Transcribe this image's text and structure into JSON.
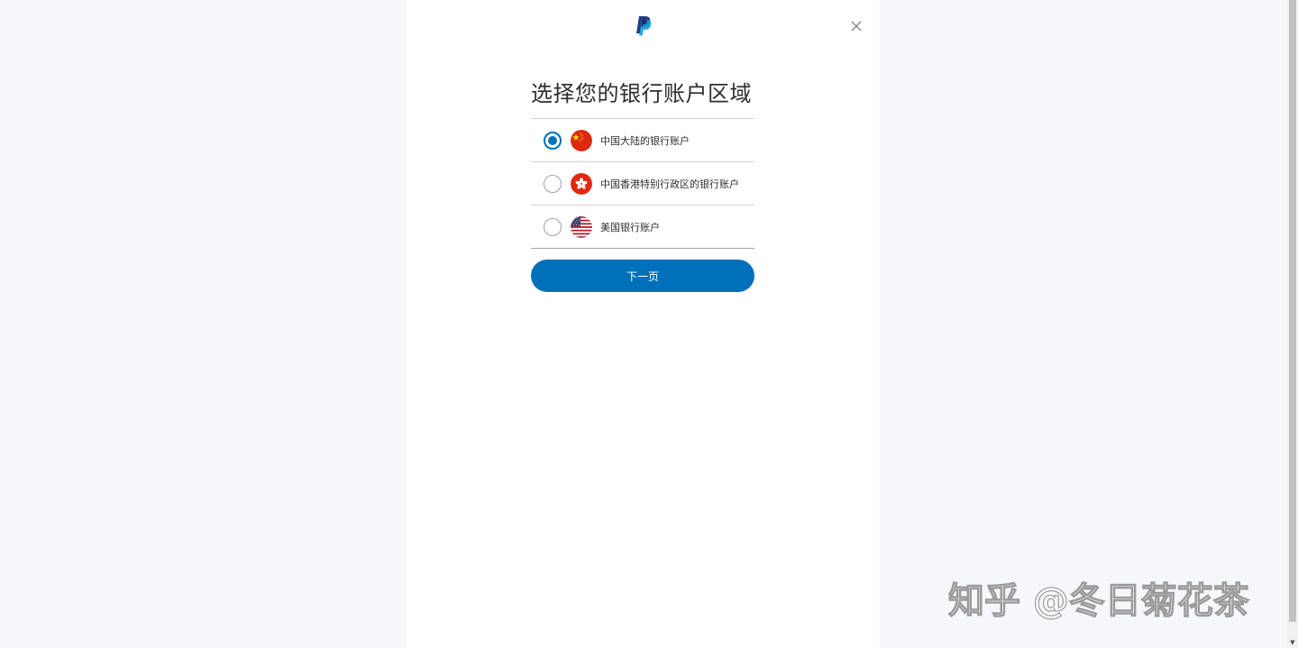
{
  "dialog": {
    "title": "选择您的银行账户区域",
    "logo_icon": "paypal-logo",
    "close_icon": "close-icon"
  },
  "options": [
    {
      "label": "中国大陆的银行账户",
      "flag": "china-flag-icon",
      "selected": true
    },
    {
      "label": "中国香港特别行政区的银行账户",
      "flag": "hong-kong-flag-icon",
      "selected": false
    },
    {
      "label": "美国银行账户",
      "flag": "us-flag-icon",
      "selected": false
    }
  ],
  "next_button": {
    "label": "下一页"
  },
  "watermark": {
    "text": "知乎 @冬日菊花茶"
  },
  "colors": {
    "primary": "#0070ba",
    "background": "#f5f7fa",
    "panel": "#ffffff",
    "text": "#2c2e2f"
  }
}
